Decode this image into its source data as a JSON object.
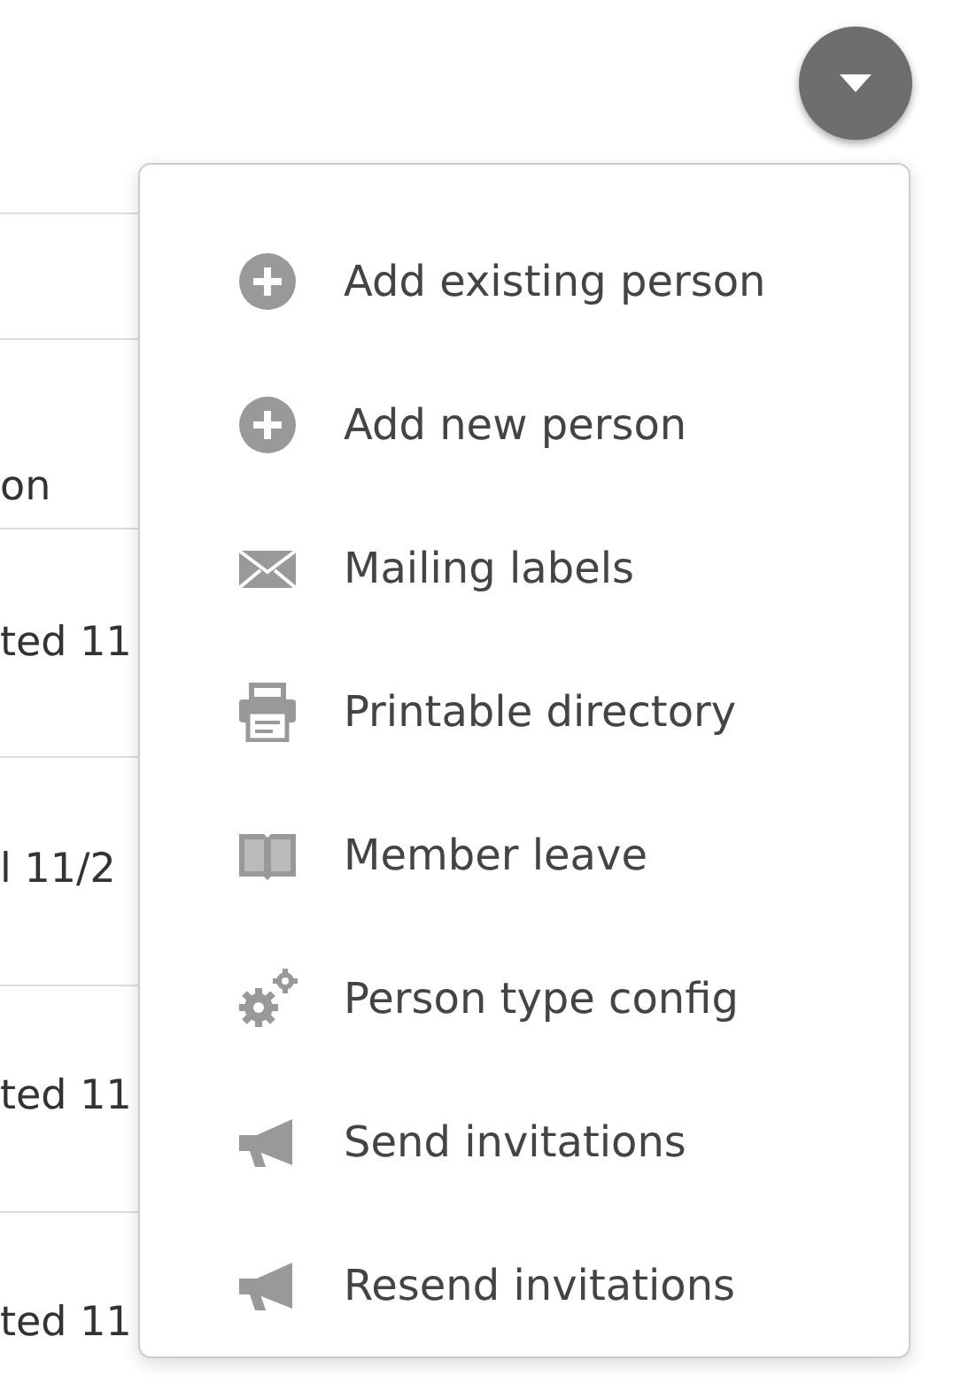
{
  "table": {
    "column_1_header": "on",
    "rows": [
      {
        "column_1": "ted 11"
      },
      {
        "column_1": "l 11/2"
      },
      {
        "column_1": "ted 11"
      },
      {
        "column_1": "ted 11"
      }
    ]
  },
  "menu": {
    "items": [
      {
        "kind": "add",
        "label": "Add existing person"
      },
      {
        "kind": "add",
        "label": "Add new person"
      },
      {
        "kind": "mail",
        "label": "Mailing labels"
      },
      {
        "kind": "print",
        "label": "Printable directory"
      },
      {
        "kind": "book",
        "label": "Member leave"
      },
      {
        "kind": "gears",
        "label": "Person type config"
      },
      {
        "kind": "megaphone",
        "label": "Send invitations"
      },
      {
        "kind": "megaphone",
        "label": "Resend invitations"
      }
    ]
  }
}
